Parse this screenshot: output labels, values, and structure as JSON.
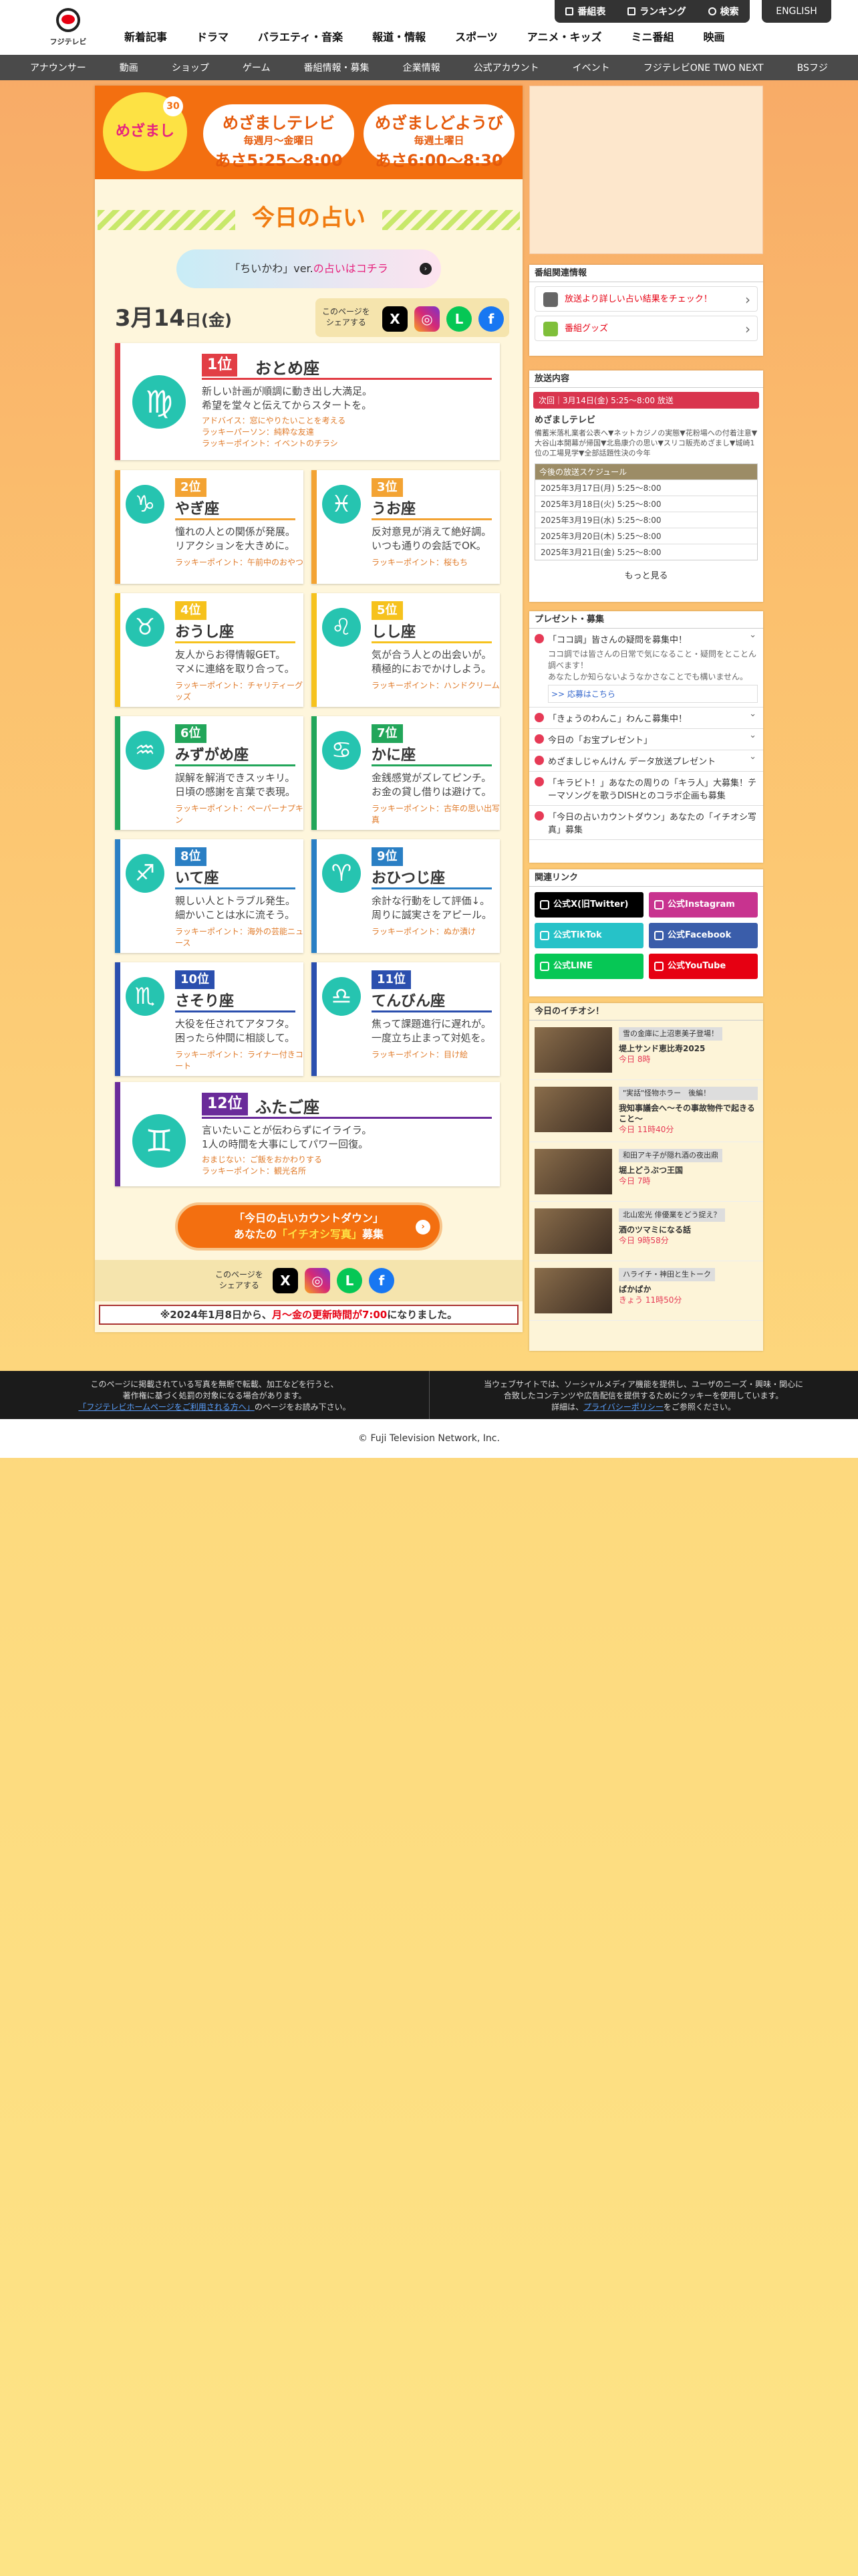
{
  "header": {
    "logo": "フジテレビ",
    "nav": [
      "新着記事",
      "ドラマ",
      "バラエティ・音楽",
      "報道・情報",
      "スポーツ",
      "アニメ・キッズ",
      "ミニ番組",
      "映画"
    ],
    "tools": [
      "番組表",
      "ランキング",
      "検索"
    ],
    "english": "ENGLISH"
  },
  "subnav": [
    "アナウンサー",
    "動画",
    "ショップ",
    "ゲーム",
    "番組情報・募集",
    "企業情報",
    "公式アカウント",
    "イベント",
    "フジテレビONE TWO NEXT",
    "BSフジ"
  ],
  "banner": {
    "logo": "めざまし",
    "anniv": "30",
    "a_title": "めざましテレビ",
    "a_days": "毎週月〜金曜日",
    "a_time": "あさ5:25〜8:00",
    "b_title": "めざましどようび",
    "b_days": "毎週土曜日",
    "b_time": "あさ6:00〜8:30"
  },
  "title": "今日の占い",
  "chiikawa": {
    "pre": "「ちいかわ」ver.",
    "link": "の占いはコチラ"
  },
  "date": {
    "md": "3月14",
    "d": "日",
    "w": "(金)"
  },
  "share_label": "このページを\nシェアする",
  "signs": [
    {
      "rank": "1位",
      "name": "おとめ座",
      "desc": "新しい計画が順調に動き出し大満足。\n希望を堂々と伝えてからスタートを。",
      "advice": "アドバイス：窓にやりたいことを考える",
      "person": "ラッキーパーソン：純粋な友達",
      "point": "ラッキーポイント：イベントのチラシ",
      "color": "#e23e45",
      "sym": "♍"
    },
    {
      "rank": "2位",
      "name": "やぎ座",
      "desc": "憧れの人との関係が発展。\nリアクションを大きめに。",
      "point": "ラッキーポイント：午前中のおやつ",
      "color": "#f3a333",
      "sym": "♑"
    },
    {
      "rank": "3位",
      "name": "うお座",
      "desc": "反対意見が消えて絶好調。\nいつも通りの会話でOK。",
      "point": "ラッキーポイント：桜もち",
      "color": "#f3a333",
      "sym": "♓"
    },
    {
      "rank": "4位",
      "name": "おうし座",
      "desc": "友人からお得情報GET。\nマメに連絡を取り合って。",
      "point": "ラッキーポイント：チャリティーグッズ",
      "color": "#f6c21d",
      "sym": "♉"
    },
    {
      "rank": "5位",
      "name": "しし座",
      "desc": "気が合う人との出会いが。\n積極的におでかけしよう。",
      "point": "ラッキーポイント：ハンドクリーム",
      "color": "#f6c21d",
      "sym": "♌"
    },
    {
      "rank": "6位",
      "name": "みずがめ座",
      "desc": "誤解を解消できスッキリ。\n日頃の感謝を言葉で表現。",
      "point": "ラッキーポイント：ペーパーナプキン",
      "color": "#22a65a",
      "sym": "♒"
    },
    {
      "rank": "7位",
      "name": "かに座",
      "desc": "金銭感覚がズレてピンチ。\nお金の貸し借りは避けて。",
      "point": "ラッキーポイント：古年の思い出写真",
      "color": "#22a65a",
      "sym": "♋"
    },
    {
      "rank": "8位",
      "name": "いて座",
      "desc": "親しい人とトラブル発生。\n細かいことは水に流そう。",
      "point": "ラッキーポイント：海外の芸能ニュース",
      "color": "#2a7fc4",
      "sym": "♐"
    },
    {
      "rank": "9位",
      "name": "おひつじ座",
      "desc": "余計な行動をして評価↓。\n周りに誠実さをアピール。",
      "point": "ラッキーポイント：ぬか漬け",
      "color": "#2a7fc4",
      "sym": "♈"
    },
    {
      "rank": "10位",
      "name": "さそり座",
      "desc": "大役を任されてアタフタ。\n困ったら仲間に相談して。",
      "point": "ラッキーポイント：ライナー付きコート",
      "color": "#2b4fae",
      "sym": "♏"
    },
    {
      "rank": "11位",
      "name": "てんびん座",
      "desc": "焦って課題進行に遅れが。\n一度立ち止まって対処を。",
      "point": "ラッキーポイント：目け絵",
      "color": "#2b4fae",
      "sym": "♎"
    },
    {
      "rank": "12位",
      "name": "ふたご座",
      "desc": "言いたいことが伝わらずにイライラ。\n1人の時間を大事にしてパワー回復。",
      "advice": "おまじない：ご飯をおかわりする",
      "point": "ラッキーポイント：観光名所",
      "color": "#6a2b9a",
      "sym": "♊"
    }
  ],
  "countdown": {
    "l1": "「今日の占いカウントダウン」",
    "l2a": "あなたの",
    "l2b": "「イチオシ写真」",
    "l2c": "募集"
  },
  "notice": {
    "a": "※2024年1月8日から、",
    "b": "月〜金の更新時間が7:00",
    "c": "になりました。"
  },
  "side": {
    "kanren": "番組関連情報",
    "btn1": "放送より詳しい占い結果をチェック！",
    "btn2": "番組グッズ",
    "housou": "放送内容",
    "next": "次回｜3月14日(金) 5:25〜8:00 放送",
    "ptitle": "めざましテレビ",
    "pdesc": "備蓄米落札業者公表へ▼ネットカジノの実態▼花粉場への付着注意▼大谷山本開幕が帰国▼北島康介の思い▼スリコ販売めざまし▼城崎1位の工場見学▼全部話題性決の今年",
    "sched_h": "今後の放送スケジュール",
    "sched": [
      "2025年3月17日(月) 5:25〜8:00",
      "2025年3月18日(火) 5:25〜8:00",
      "2025年3月19日(水) 5:25〜8:00",
      "2025年3月20日(木) 5:25〜8:00",
      "2025年3月21日(金) 5:25〜8:00"
    ],
    "more": "もっと見る",
    "present": "プレゼント・募集",
    "p1": "「ココ調」皆さんの疑問を募集中！",
    "p1sub": "ココ調では皆さんの日常で気になること・疑問をとことん調べます！\nあなたしか知らないようなかさなことでも構いません。",
    "p1link": ">> 応募はこちら",
    "p2": "「きょうのわんこ」わんこ募集中！",
    "p3": "今日の「お宝プレゼント」",
    "p4": "めざましじゃんけん データ放送プレゼント",
    "p5": "「キラビト！」あなたの周りの「キラ人」大募集！テーマソングを歌うDISHとのコラボ企画も募集",
    "p6": "「今日の占いカウントダウン」あなたの「イチオシ写真」募集",
    "links_h": "関連リンク",
    "links": [
      "公式X(旧Twitter)",
      "公式Instagram",
      "公式TikTok",
      "公式Facebook",
      "公式LINE",
      "公式YouTube"
    ],
    "pick_h": "今日のイチオシ！",
    "picks": [
      {
        "tag": "雪の金庫に上沼恵美子登場！",
        "title": "堤上サンド恵比寿2025",
        "time": "今日 8時"
      },
      {
        "tag": "\"実話\"怪物ホラー　後編！",
        "title": "我知事議会へ〜その事故物件で起きること〜",
        "time": "今日 11時40分"
      },
      {
        "tag": "和田アキ子が隠れ酒の夜出鼎",
        "title": "堀上どうぶつ王国",
        "time": "今日 7時"
      },
      {
        "tag": "北山宏光 俳優業をどう捉え？",
        "title": "酒のツマミになる話",
        "time": "今日 9時58分"
      },
      {
        "tag": "ハライチ・神田と生トーク",
        "title": "ぱかぱか",
        "time": "きょう 11時50分"
      }
    ]
  },
  "footer": {
    "l1": "このページに掲載されている写真を無断で転載、加工などを行うと、",
    "l2": "著作権に基づく処罰の対象になる場合があります。",
    "l3a": "「フジテレビホームページをご利用される方へ」",
    "l3b": "のページをお読み下さい。",
    "r1": "当ウェブサイトでは、ソーシャルメディア機能を提供し、ユーザのニーズ・興味・関心に",
    "r2": "合致したコンテンツや広告配信を提供するためにクッキーを使用しています。",
    "r3a": "詳細は、",
    "r3b": "プライバシーポリシー",
    "r3c": "をご参照ください。"
  },
  "copyright": "© Fuji Television Network, Inc."
}
